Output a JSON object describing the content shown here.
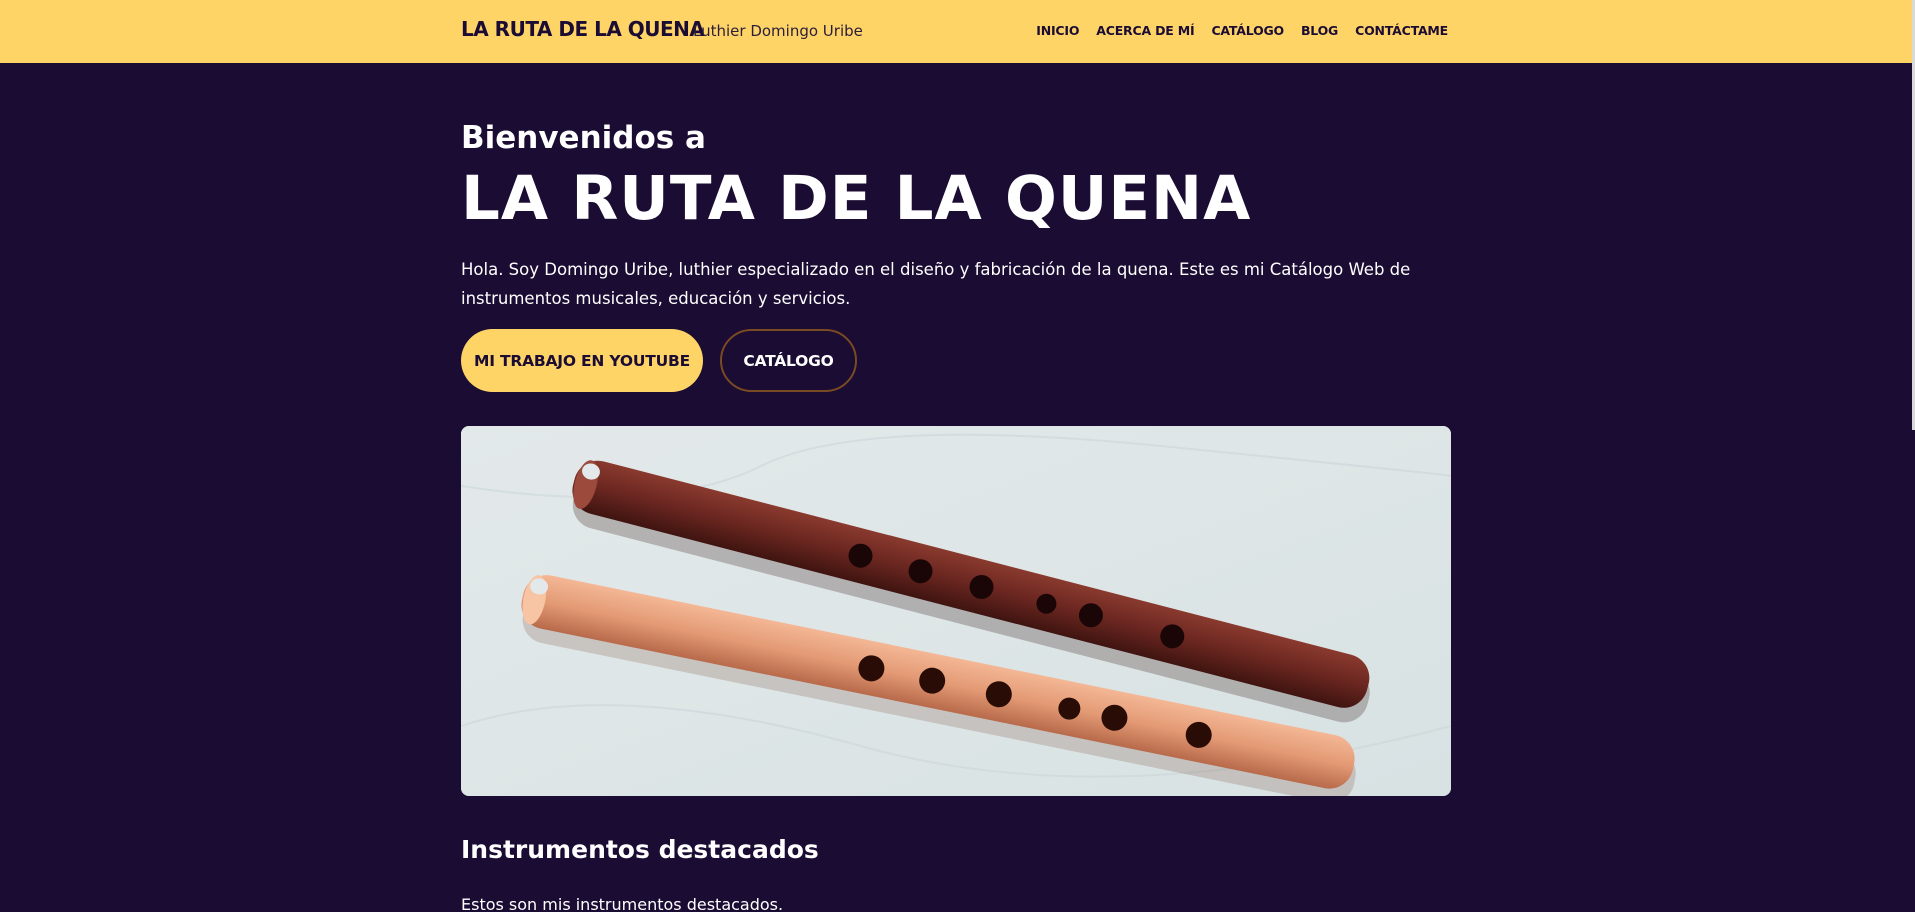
{
  "header": {
    "brand": "LA RUTA DE LA QUENA",
    "tagline": "Luthier Domingo Uribe",
    "nav": [
      "INICIO",
      "ACERCA DE MÍ",
      "CATÁLOGO",
      "BLOG",
      "CONTÁCTAME"
    ]
  },
  "hero": {
    "welcome": "Bienvenidos a",
    "title": "LA RUTA DE LA QUENA",
    "intro": "Hola. Soy Domingo Uribe, luthier especializado en el diseño y fabricación de la quena. Este es mi Catálogo Web de instrumentos musicales, educación y servicios.",
    "primary_button": "MI TRABAJO EN YOUTUBE",
    "secondary_button": "CATÁLOGO"
  },
  "featured": {
    "title": "Instrumentos destacados",
    "text": "Estos son mis instrumentos destacados."
  },
  "colors": {
    "background": "#1b0c33",
    "accent": "#ffd466",
    "text": "#ffffff"
  }
}
